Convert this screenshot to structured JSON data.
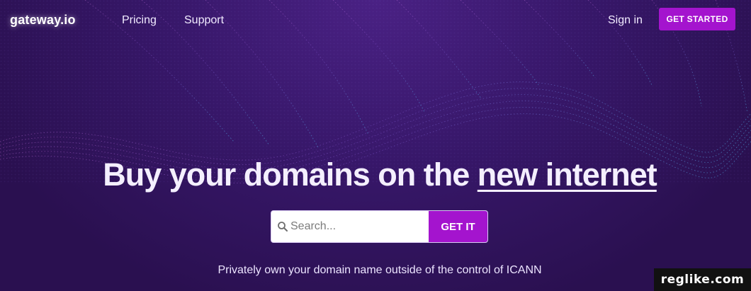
{
  "nav": {
    "logo": "gateway.io",
    "links": [
      "Pricing",
      "Support"
    ],
    "sign_in": "Sign in",
    "cta": "GET STARTED"
  },
  "hero": {
    "headline_prefix": "Buy your domains on the ",
    "headline_link": "new internet",
    "search": {
      "placeholder": "Search...",
      "value": "",
      "button": "GET IT"
    },
    "tagline": "Privately own your domain name outside of the control of ICANN"
  },
  "watermark": "reglike.com",
  "colors": {
    "background": "#2e1257",
    "accent": "#a414ce",
    "wave_dots_left": "#c06ad8",
    "wave_dots_right": "#4ea7e0"
  },
  "icons": {
    "search": "search-icon"
  }
}
